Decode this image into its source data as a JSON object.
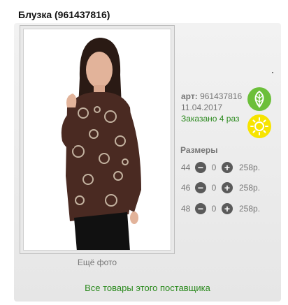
{
  "product": {
    "title": "Блузка (961437816)",
    "more_photos_label": "Ещё фото",
    "article_label": "арт:",
    "article_value": "961437816",
    "date": "11.04.2017",
    "ordered_text": "Заказано 4 раз",
    "supplier_link": "Все товары этого поставщика"
  },
  "badges": [
    {
      "icon": "leaf-icon",
      "color": "#6cbf3a"
    },
    {
      "icon": "sun-icon",
      "color": "#f7e400"
    }
  ],
  "sizes": {
    "title": "Размеры",
    "rows": [
      {
        "size": "44",
        "qty": "0",
        "price": "258р."
      },
      {
        "size": "46",
        "qty": "0",
        "price": "258р."
      },
      {
        "size": "48",
        "qty": "0",
        "price": "258р."
      }
    ]
  },
  "colors": {
    "accent_green": "#2b8a1e",
    "button_gray": "#5a5a5a"
  }
}
